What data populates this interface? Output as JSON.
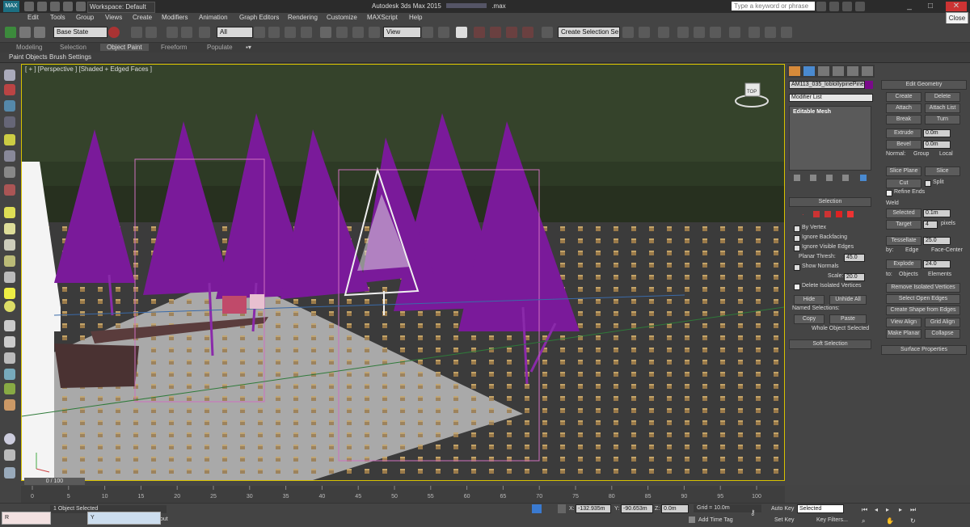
{
  "titlebar": {
    "app_logo": "MAX",
    "workspace": "Workspace: Default",
    "title": "Autodesk 3ds Max 2015",
    "file_suffix": ".max",
    "search_placeholder": "Type a keyword or phrase",
    "close_tooltip": "Close"
  },
  "menu": [
    "Edit",
    "Tools",
    "Group",
    "Views",
    "Create",
    "Modifiers",
    "Animation",
    "Graph Editors",
    "Rendering",
    "Customize",
    "MAXScript",
    "Help"
  ],
  "toolbar": {
    "state_set": "Base State",
    "selection_filter": "All",
    "ref_coord": "View",
    "selection_set": "Create Selection Se"
  },
  "ribbon": {
    "tabs": [
      "Modeling",
      "Selection",
      "Object Paint",
      "Freeform",
      "Populate"
    ],
    "active_tab": "Object Paint",
    "panels": [
      "Paint Objects",
      "Brush Settings"
    ]
  },
  "viewport": {
    "label": "[ + ] [Perspective ] [Shaded + Edged Faces ]",
    "viewcube_label": "TOP"
  },
  "command_panel": {
    "object_name": "AM113_035_loblollypinePine0",
    "object_color": "#7a0a8a",
    "modifier_list": "Modifier List",
    "stack_item": "Editable Mesh",
    "selection": {
      "title": "Selection",
      "by_vertex": "By Vertex",
      "ignore_backfacing": "Ignore Backfacing",
      "ignore_visible_edges": "Ignore Visible Edges",
      "planar_thresh_label": "Planar Thresh:",
      "planar_thresh": "45.0",
      "show_normals": "Show Normals",
      "scale_label": "Scale:",
      "scale": "20.0",
      "delete_isolated": "Delete Isolated Vertices",
      "hide": "Hide",
      "unhide_all": "Unhide All",
      "named_selections": "Named Selections:",
      "copy": "Copy",
      "paste": "Paste",
      "status": "Whole Object Selected"
    },
    "soft_selection": "Soft Selection",
    "edit_geometry": {
      "title": "Edit Geometry",
      "create": "Create",
      "delete": "Delete",
      "attach": "Attach",
      "attach_list": "Attach List",
      "break": "Break",
      "turn": "Turn",
      "extrude": "Extrude",
      "extrude_val": "0.0m",
      "bevel": "Bevel",
      "bevel_val": "0.0m",
      "normal_label": "Normal:",
      "group": "Group",
      "local": "Local",
      "slice_plane": "Slice Plane",
      "slice": "Slice",
      "cut": "Cut",
      "split": "Split",
      "refine_ends": "Refine Ends",
      "weld": "Weld",
      "selected": "Selected",
      "selected_val": "0.1m",
      "target": "Target",
      "target_val": "4",
      "pixels": "pixels",
      "tessellate": "Tessellate",
      "tessellate_val": "25.0",
      "by_label": "by:",
      "edge": "Edge",
      "face_center": "Face-Center",
      "explode": "Explode",
      "explode_val": "24.0",
      "to_label": "to:",
      "objects": "Objects",
      "elements": "Elements",
      "remove_isolated": "Remove Isolated Vertices",
      "select_open_edges": "Select Open Edges",
      "create_shape": "Create Shape from Edges",
      "view_align": "View Align",
      "grid_align": "Grid Align",
      "make_planar": "Make Planar",
      "collapse": "Collapse"
    },
    "surface_properties": "Surface Properties"
  },
  "timeline": {
    "slider": "0 / 100",
    "ticks": [
      "0",
      "5",
      "10",
      "15",
      "20",
      "25",
      "30",
      "35",
      "40",
      "45",
      "50",
      "55",
      "60",
      "65",
      "70",
      "75",
      "80",
      "85",
      "90",
      "95",
      "100"
    ]
  },
  "status": {
    "selected": "1 Object Selected",
    "x_label": "X:",
    "x": "-132.935m",
    "y_label": "Y:",
    "y": "-90.653m",
    "z_label": "Z:",
    "z": "0.0m",
    "grid": "Grid = 10.0m",
    "add_time_tag": "Add Time Tag",
    "auto_key": "Auto Key",
    "set_key": "Set Key",
    "key_mode": "Selected",
    "key_filters": "Key Filters...",
    "prompt_tail": "out"
  },
  "taskbar": {
    "items": [
      "R",
      "Y"
    ]
  }
}
